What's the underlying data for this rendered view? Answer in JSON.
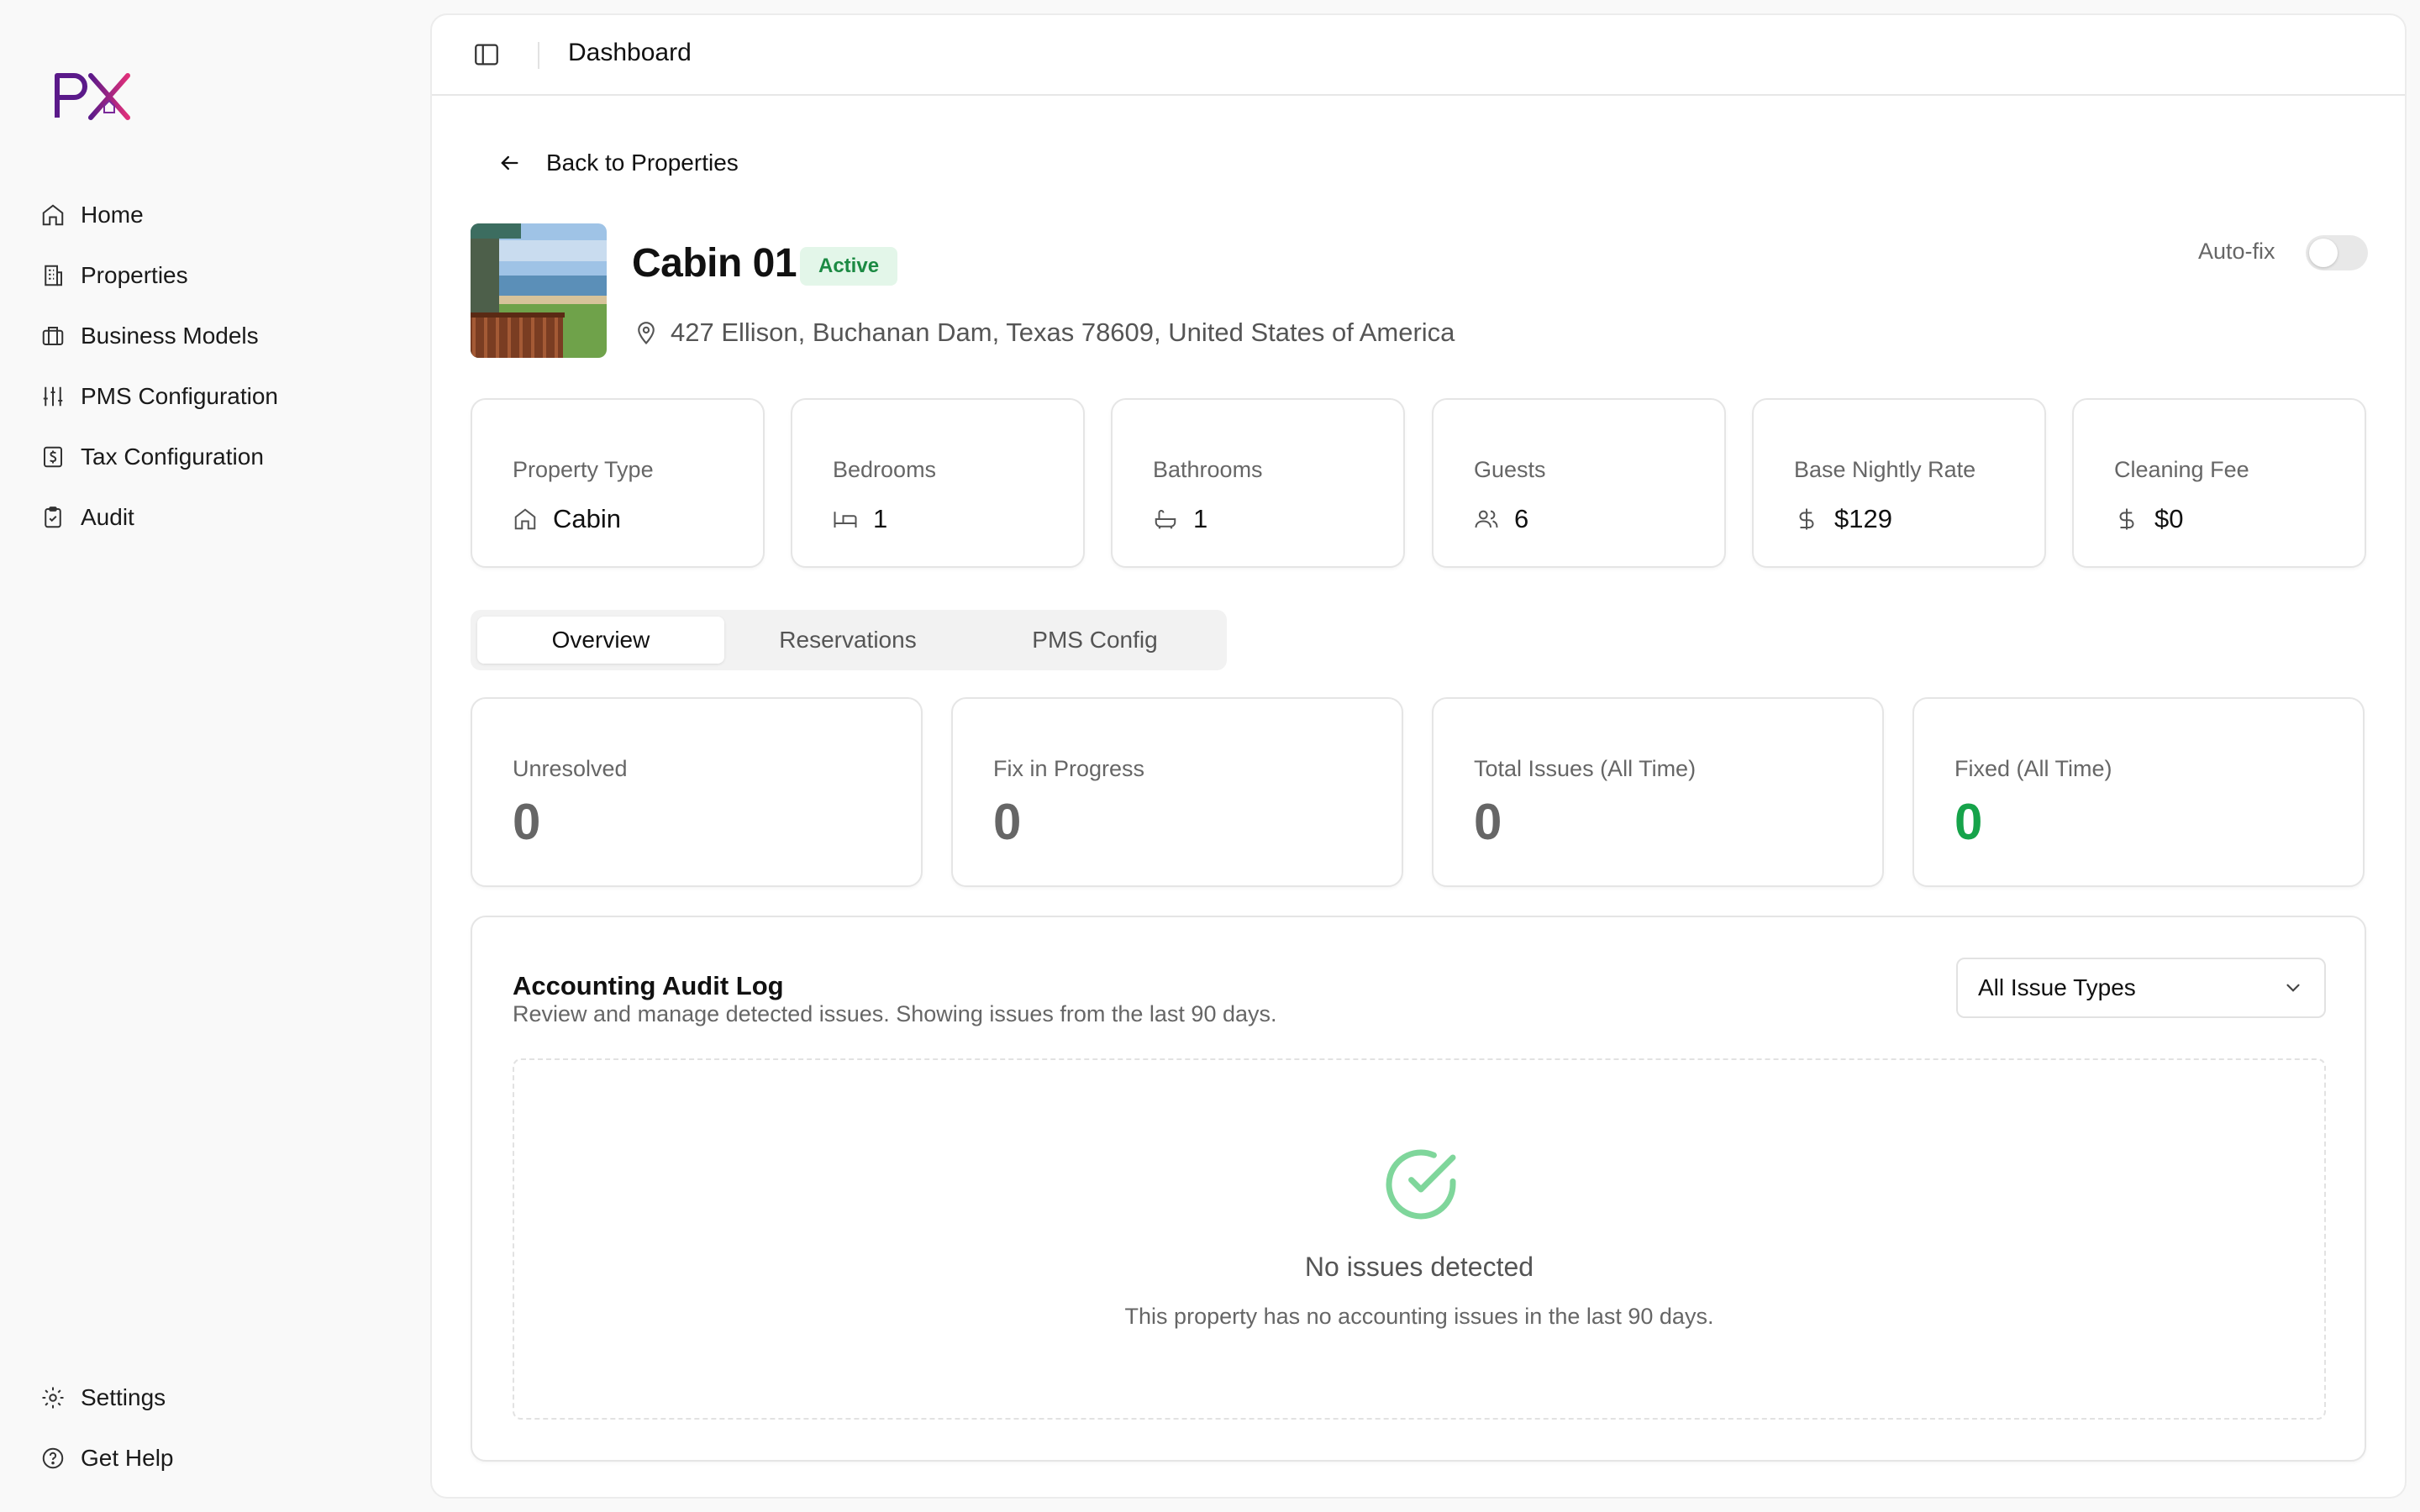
{
  "app": {
    "logo_text": "PX"
  },
  "sidebar": {
    "items": [
      {
        "label": "Home",
        "icon": "home-icon"
      },
      {
        "label": "Properties",
        "icon": "building-icon"
      },
      {
        "label": "Business Models",
        "icon": "briefcase-icon"
      },
      {
        "label": "PMS Configuration",
        "icon": "sliders-icon"
      },
      {
        "label": "Tax Configuration",
        "icon": "receipt-icon"
      },
      {
        "label": "Audit",
        "icon": "clipboard-check-icon"
      }
    ],
    "footer_items": [
      {
        "label": "Settings",
        "icon": "gear-icon"
      },
      {
        "label": "Get Help",
        "icon": "help-circle-icon"
      }
    ]
  },
  "header": {
    "title": "Dashboard"
  },
  "back_link": "Back to Properties",
  "property": {
    "name": "Cabin 01",
    "status": "Active",
    "address": "427 Ellison, Buchanan Dam, Texas 78609, United States of America"
  },
  "autofix": {
    "label": "Auto-fix",
    "enabled": false
  },
  "stats": [
    {
      "label": "Property Type",
      "value": "Cabin",
      "icon": "home-icon"
    },
    {
      "label": "Bedrooms",
      "value": "1",
      "icon": "bed-icon"
    },
    {
      "label": "Bathrooms",
      "value": "1",
      "icon": "bath-icon"
    },
    {
      "label": "Guests",
      "value": "6",
      "icon": "users-icon"
    },
    {
      "label": "Base Nightly Rate",
      "value": "$129",
      "icon": "dollar-icon"
    },
    {
      "label": "Cleaning Fee",
      "value": "$0",
      "icon": "dollar-icon"
    }
  ],
  "tabs": [
    {
      "label": "Overview",
      "active": true
    },
    {
      "label": "Reservations",
      "active": false
    },
    {
      "label": "PMS Config",
      "active": false
    }
  ],
  "metrics": [
    {
      "label": "Unresolved",
      "value": "0"
    },
    {
      "label": "Fix in Progress",
      "value": "0"
    },
    {
      "label": "Total Issues (All Time)",
      "value": "0"
    },
    {
      "label": "Fixed (All Time)",
      "value": "0"
    }
  ],
  "audit": {
    "title": "Accounting Audit Log",
    "subtitle": "Review and manage detected issues. Showing issues from the last 90 days.",
    "filter": {
      "selected": "All Issue Types"
    },
    "empty": {
      "title": "No issues detected",
      "subtitle": "This property has no accounting issues in the last 90 days."
    }
  },
  "colors": {
    "accent_green": "#16a34a",
    "badge_bg": "#e3f6e9",
    "logo_purple": "#5b1a8a",
    "logo_pink": "#e0307a"
  }
}
